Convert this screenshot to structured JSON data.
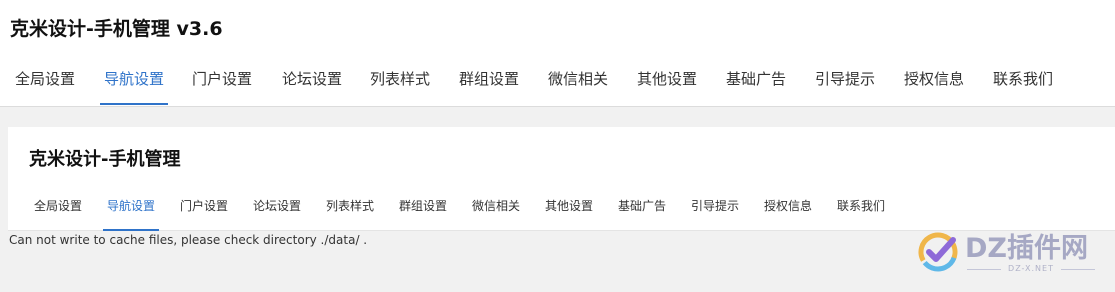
{
  "app": {
    "title": "克米设计-手机管理 v3.6",
    "tabs": [
      {
        "label": "全局设置",
        "active": false
      },
      {
        "label": "导航设置",
        "active": true
      },
      {
        "label": "门户设置",
        "active": false
      },
      {
        "label": "论坛设置",
        "active": false
      },
      {
        "label": "列表样式",
        "active": false
      },
      {
        "label": "群组设置",
        "active": false
      },
      {
        "label": "微信相关",
        "active": false
      },
      {
        "label": "其他设置",
        "active": false
      },
      {
        "label": "基础广告",
        "active": false
      },
      {
        "label": "引导提示",
        "active": false
      },
      {
        "label": "授权信息",
        "active": false
      },
      {
        "label": "联系我们",
        "active": false
      }
    ]
  },
  "inner": {
    "title": "克米设计-手机管理",
    "tabs": [
      {
        "label": "全局设置",
        "active": false
      },
      {
        "label": "导航设置",
        "active": true
      },
      {
        "label": "门户设置",
        "active": false
      },
      {
        "label": "论坛设置",
        "active": false
      },
      {
        "label": "列表样式",
        "active": false
      },
      {
        "label": "群组设置",
        "active": false
      },
      {
        "label": "微信相关",
        "active": false
      },
      {
        "label": "其他设置",
        "active": false
      },
      {
        "label": "基础广告",
        "active": false
      },
      {
        "label": "引导提示",
        "active": false
      },
      {
        "label": "授权信息",
        "active": false
      },
      {
        "label": "联系我们",
        "active": false
      }
    ]
  },
  "error": {
    "message": "Can not write to cache files, please check directory ./data/ ."
  },
  "watermark": {
    "name": "DZ插件网",
    "domain": "DZ-X.NET"
  },
  "colors": {
    "accent": "#2f73c9",
    "background": "#f1f1f1",
    "panel": "#ffffff"
  }
}
